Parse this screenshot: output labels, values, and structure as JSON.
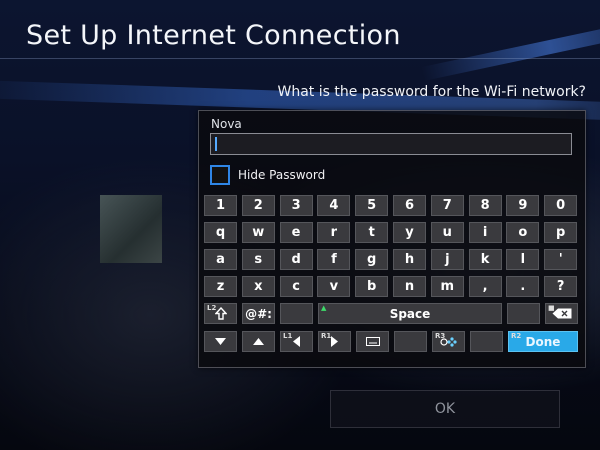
{
  "header": {
    "title": "Set Up Internet Connection"
  },
  "prompt": "What is the password for the Wi-Fi network?",
  "keyboard_panel": {
    "network_name": "Nova",
    "password_value": "",
    "hide_password": {
      "label": "Hide Password",
      "checked": false
    },
    "rows": [
      [
        "1",
        "2",
        "3",
        "4",
        "5",
        "6",
        "7",
        "8",
        "9",
        "0"
      ],
      [
        "q",
        "w",
        "e",
        "r",
        "t",
        "y",
        "u",
        "i",
        "o",
        "p"
      ],
      [
        "a",
        "s",
        "d",
        "f",
        "g",
        "h",
        "j",
        "k",
        "l",
        "'"
      ],
      [
        "z",
        "x",
        "c",
        "v",
        "b",
        "n",
        "m",
        ",",
        ".",
        "?"
      ]
    ],
    "function_row": {
      "shift_hint": "L2",
      "symbols_label": "@#:",
      "triangle_hint": "▲",
      "space_label": "Space",
      "square_hint": "■"
    },
    "nav_row": {
      "l1_hint": "L1",
      "r1_hint": "R1",
      "r3_hint": "R3",
      "r2_hint": "R2",
      "done_label": "Done"
    }
  },
  "ok_button": {
    "label": "OK"
  },
  "colors": {
    "accent": "#2f86e6",
    "done_key": "#29a9e8",
    "triangle_green": "#3ddc6a"
  }
}
